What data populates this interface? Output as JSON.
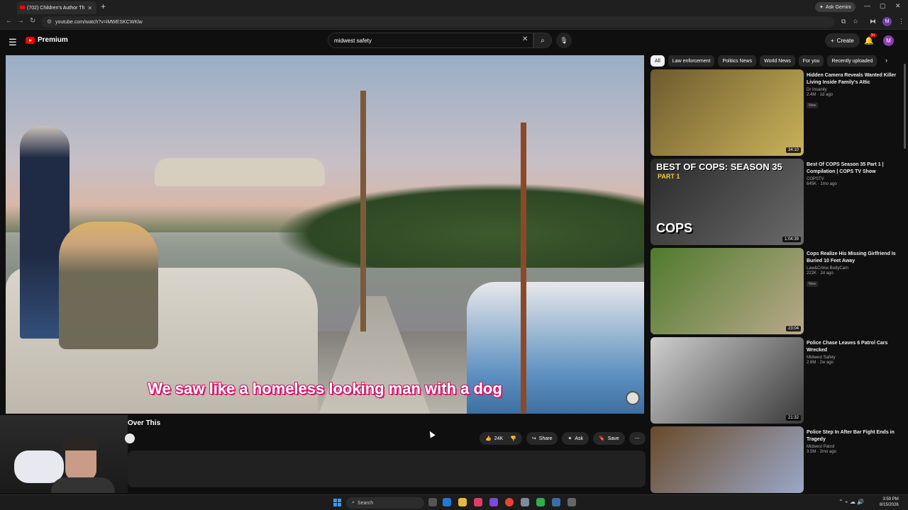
{
  "browser": {
    "tab_title": "(702) Children's Author Th",
    "tab_close": "✕",
    "new_tab": "+",
    "ask_gemini": "Ask Gemini",
    "url": "youtube.com/watch?v=iMWESKCWKlw"
  },
  "header": {
    "logo_text": "Premium",
    "search_value": "midwest safety",
    "create_label": "Create",
    "notifications_badge": "9+",
    "avatar_letter": "M"
  },
  "player": {
    "subtitle": "We saw like a homeless looking man with a dog"
  },
  "video": {
    "title": "Over This",
    "like_count": "24K",
    "share_label": "Share",
    "ask_label": "Ask",
    "save_label": "Save"
  },
  "chips": [
    "All",
    "Law enforcement",
    "Politics News",
    "World News",
    "For you",
    "Recently uploaded"
  ],
  "recommendations": [
    {
      "title": "Hidden Camera Reveals Wanted Killer Living Inside Family's Attic",
      "channel": "Dr Insanity",
      "stats": "2.4M · 1d ago",
      "badge": "New",
      "duration": "34:10",
      "color_a": "#6e5a2e",
      "color_b": "#c9b35a"
    },
    {
      "title": "Best Of COPS Season 35 Part 1 | Compilation | COPS TV Show",
      "channel": "COPSTV",
      "stats": "645K · 1mo ago",
      "badge": "",
      "duration": "1:04:39",
      "color_a": "#2a2a2a",
      "color_b": "#6a6a6a",
      "banner": "BEST OF COPS: SEASON 35",
      "banner_part": "PART 1",
      "banner_logo": "COPS"
    },
    {
      "title": "Cops Realize His Missing Girlfriend Is Buried 10 Feet Away",
      "channel": "Law&Crime BodyCam",
      "stats": "222K · 2d ago",
      "badge": "New",
      "duration": "23:04",
      "color_a": "#4f7a2c",
      "color_b": "#b9a98a"
    },
    {
      "title": "Police Chase Leaves 6 Patrol Cars Wrecked",
      "channel": "Midwest Safety",
      "stats": "2.6M · 2w ago",
      "badge": "",
      "duration": "21:32",
      "color_a": "#cfcfcf",
      "color_b": "#3a3a3a"
    },
    {
      "title": "Police Step In After Bar Fight Ends in Tragedy",
      "channel": "Midwest Patrol",
      "stats": "3.5M · 2mo ago",
      "badge": "",
      "duration": "",
      "color_a": "#6a4a2a",
      "color_b": "#9aa8c8"
    }
  ],
  "taskbar": {
    "search_label": "Search",
    "time": "3:59 PM",
    "date": "8/15/2026"
  },
  "icons": {
    "hamburger": "☰",
    "search": "⌕",
    "mic": "🎙",
    "bell": "🔔",
    "like": "👍",
    "dislike": "👎",
    "share": "↪",
    "ask": "✦",
    "save": "🔖",
    "more": "⋯",
    "clear": "✕",
    "plus": "+",
    "chevron_right": "›",
    "back": "←",
    "forward": "→",
    "reload": "↻"
  }
}
